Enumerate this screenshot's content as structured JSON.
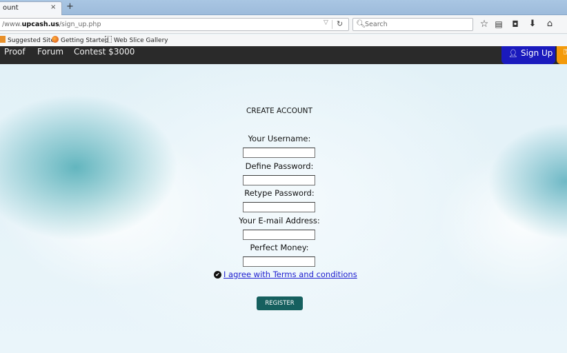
{
  "browser": {
    "tab": {
      "title": "ount",
      "close": "×"
    },
    "new_tab": "+",
    "url": {
      "prefix": "/www.",
      "host": "upcash.us",
      "path": "/sign_up.php"
    },
    "url_dropdown": "▽",
    "reload": "↻",
    "search": {
      "placeholder": "Search",
      "icon": "search-icon"
    },
    "toolbar_icons": [
      "star-icon",
      "reading-list-icon",
      "pocket-icon",
      "download-icon",
      "home-icon"
    ],
    "bookmarks": [
      {
        "label": "Suggested Sites",
        "icon": "suggested-sites-icon"
      },
      {
        "label": "Getting Started",
        "icon": "firefox-icon"
      },
      {
        "label": "Web Slice Gallery",
        "icon": "web-slice-icon"
      }
    ]
  },
  "site_nav": {
    "links": [
      "Proof",
      "Forum",
      "Contest $3000"
    ],
    "signup_label": "Sign Up",
    "signup_color": "#1a1abd",
    "accent_color": "#f39a0a"
  },
  "form": {
    "title": "CREATE ACCOUNT",
    "fields": [
      {
        "label": "Your Username:",
        "value": ""
      },
      {
        "label": "Define Password:",
        "value": ""
      },
      {
        "label": "Retype Password:",
        "value": ""
      },
      {
        "label": "Your E-mail Address:",
        "value": ""
      },
      {
        "label": "Perfect Money:",
        "value": ""
      }
    ],
    "agree_label": "I agree with Terms and conditions",
    "register_label": "REGISTER",
    "register_color": "#16605f"
  }
}
